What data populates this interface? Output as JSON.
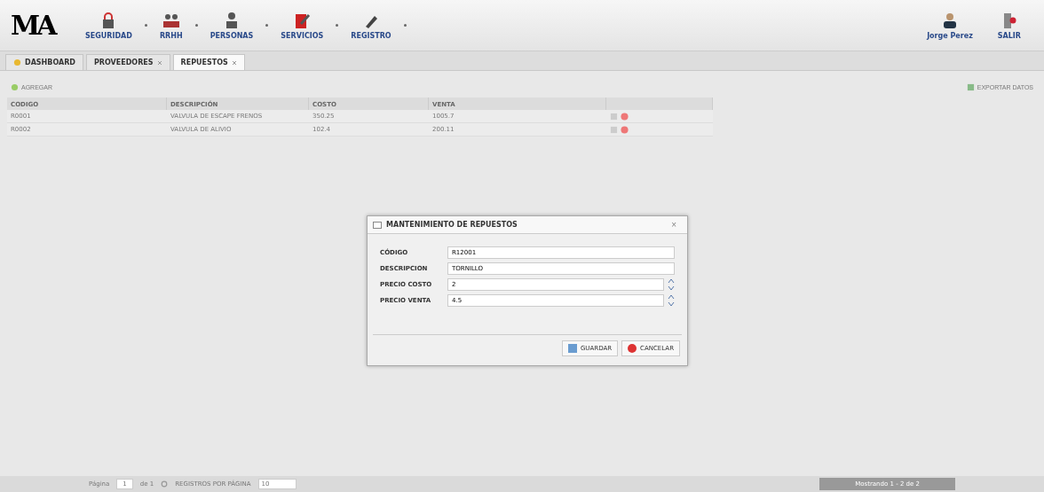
{
  "logo": "MA",
  "nav": [
    {
      "label": "SEGURIDAD",
      "kind": "lock"
    },
    {
      "label": "RRHH",
      "kind": "group"
    },
    {
      "label": "PERSONAS",
      "kind": "person"
    },
    {
      "label": "SERVICIOS",
      "kind": "edit"
    },
    {
      "label": "REGISTRO",
      "kind": "pen"
    }
  ],
  "user": {
    "name": "Jorge Perez",
    "logout": "SALIR"
  },
  "tabs": [
    {
      "label": "DASHBOARD",
      "selected": false,
      "closable": false
    },
    {
      "label": "PROVEEDORES",
      "selected": false,
      "closable": true
    },
    {
      "label": "REPUESTOS",
      "selected": true,
      "closable": true
    }
  ],
  "toolbar": {
    "add": "AGREGAR",
    "export": "EXPORTAR DATOS"
  },
  "table": {
    "columns": [
      "CODIGO",
      "DESCRIPCIÓN",
      "COSTO",
      "VENTA"
    ],
    "rows": [
      [
        "R0001",
        "VALVULA DE ESCAPE FRENOS",
        "350.25",
        "1005.7"
      ],
      [
        "R0002",
        "VALVULA DE ALIVIO",
        "102.4",
        "200.11"
      ]
    ]
  },
  "dialog": {
    "title": "MANTENIMIENTO DE REPUESTOS",
    "close": "×",
    "fields": [
      {
        "label": "CÓDIGO",
        "value": "R12001",
        "kind": "text"
      },
      {
        "label": "DESCRIPCION",
        "value": "TORNILLO",
        "kind": "text"
      },
      {
        "label": "PRECIO COSTO",
        "value": "2",
        "kind": "spinner"
      },
      {
        "label": "PRECIO VENTA",
        "value": "4.5",
        "kind": "spinner"
      }
    ],
    "save": "GUARDAR",
    "cancel": "CANCELAR"
  },
  "footer": {
    "page_label": "Página",
    "page": "1",
    "of": "de 1",
    "per_page_label": "REGISTROS POR PÁGINA",
    "per_page": "10",
    "summary": "Mostrando 1 - 2 de 2"
  }
}
